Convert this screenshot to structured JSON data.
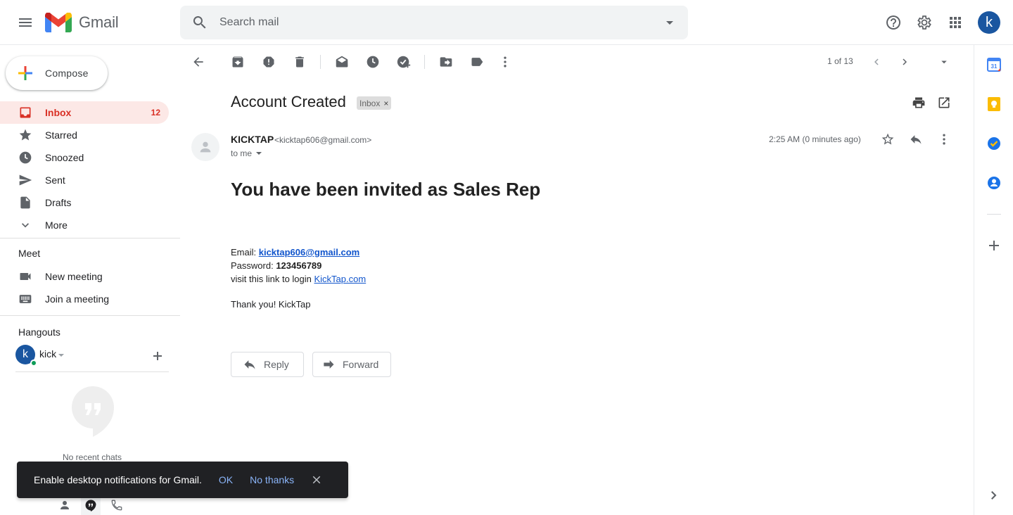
{
  "app": {
    "name": "Gmail"
  },
  "search": {
    "placeholder": "Search mail"
  },
  "header": {
    "avatar_letter": "k"
  },
  "compose": {
    "label": "Compose"
  },
  "sidebar": {
    "items": [
      {
        "label": "Inbox",
        "count": "12",
        "icon": "inbox-icon"
      },
      {
        "label": "Starred",
        "icon": "star-icon"
      },
      {
        "label": "Snoozed",
        "icon": "clock-icon"
      },
      {
        "label": "Sent",
        "icon": "send-icon"
      },
      {
        "label": "Drafts",
        "icon": "draft-icon"
      },
      {
        "label": "More",
        "icon": "chevron-down-icon"
      }
    ],
    "meet_title": "Meet",
    "meet_items": [
      {
        "label": "New meeting",
        "icon": "video-icon"
      },
      {
        "label": "Join a meeting",
        "icon": "keyboard-icon"
      }
    ],
    "hangouts_title": "Hangouts",
    "hangouts_user": {
      "letter": "k",
      "name": "kick"
    },
    "no_chats": "No recent chats"
  },
  "toolbar": {
    "pager": "1 of 13"
  },
  "email": {
    "subject": "Account Created",
    "label": "Inbox",
    "sender_name": "KICKTAP",
    "sender_email": "<kicktap606@gmail.com>",
    "to": "to me",
    "time": "2:25 AM (0 minutes ago)",
    "heading": "You have been invited as Sales Rep",
    "email_label": "Email: ",
    "email_value": "kicktap606@gmail.com",
    "password_label": "Password: ",
    "password_value": "123456789",
    "login_text": "visit this link to login ",
    "login_link": "KickTap.com",
    "thanks": "Thank you! KickTap"
  },
  "actions": {
    "reply": "Reply",
    "forward": "Forward"
  },
  "snackbar": {
    "message": "Enable desktop notifications for Gmail.",
    "ok": "OK",
    "no_thanks": "No thanks"
  },
  "colors": {
    "accent_red": "#d93025",
    "link": "#1155cc",
    "avatar_blue": "#1a56a0"
  }
}
